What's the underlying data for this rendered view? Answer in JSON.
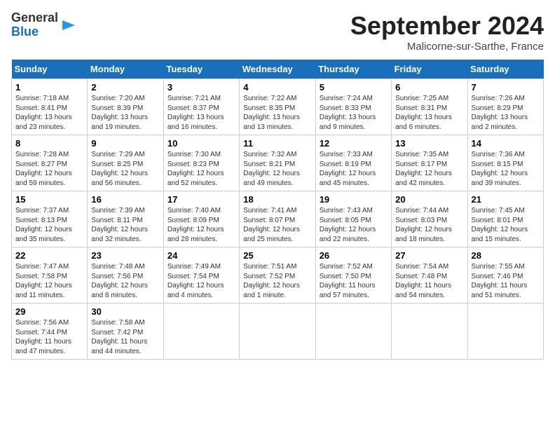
{
  "header": {
    "logo_general": "General",
    "logo_blue": "Blue",
    "title": "September 2024",
    "subtitle": "Malicorne-sur-Sarthe, France"
  },
  "days_of_week": [
    "Sunday",
    "Monday",
    "Tuesday",
    "Wednesday",
    "Thursday",
    "Friday",
    "Saturday"
  ],
  "weeks": [
    [
      {
        "day": "1",
        "info": "Sunrise: 7:18 AM\nSunset: 8:41 PM\nDaylight: 13 hours\nand 23 minutes."
      },
      {
        "day": "2",
        "info": "Sunrise: 7:20 AM\nSunset: 8:39 PM\nDaylight: 13 hours\nand 19 minutes."
      },
      {
        "day": "3",
        "info": "Sunrise: 7:21 AM\nSunset: 8:37 PM\nDaylight: 13 hours\nand 16 minutes."
      },
      {
        "day": "4",
        "info": "Sunrise: 7:22 AM\nSunset: 8:35 PM\nDaylight: 13 hours\nand 13 minutes."
      },
      {
        "day": "5",
        "info": "Sunrise: 7:24 AM\nSunset: 8:33 PM\nDaylight: 13 hours\nand 9 minutes."
      },
      {
        "day": "6",
        "info": "Sunrise: 7:25 AM\nSunset: 8:31 PM\nDaylight: 13 hours\nand 6 minutes."
      },
      {
        "day": "7",
        "info": "Sunrise: 7:26 AM\nSunset: 8:29 PM\nDaylight: 13 hours\nand 2 minutes."
      }
    ],
    [
      {
        "day": "8",
        "info": "Sunrise: 7:28 AM\nSunset: 8:27 PM\nDaylight: 12 hours\nand 59 minutes."
      },
      {
        "day": "9",
        "info": "Sunrise: 7:29 AM\nSunset: 8:25 PM\nDaylight: 12 hours\nand 56 minutes."
      },
      {
        "day": "10",
        "info": "Sunrise: 7:30 AM\nSunset: 8:23 PM\nDaylight: 12 hours\nand 52 minutes."
      },
      {
        "day": "11",
        "info": "Sunrise: 7:32 AM\nSunset: 8:21 PM\nDaylight: 12 hours\nand 49 minutes."
      },
      {
        "day": "12",
        "info": "Sunrise: 7:33 AM\nSunset: 8:19 PM\nDaylight: 12 hours\nand 45 minutes."
      },
      {
        "day": "13",
        "info": "Sunrise: 7:35 AM\nSunset: 8:17 PM\nDaylight: 12 hours\nand 42 minutes."
      },
      {
        "day": "14",
        "info": "Sunrise: 7:36 AM\nSunset: 8:15 PM\nDaylight: 12 hours\nand 39 minutes."
      }
    ],
    [
      {
        "day": "15",
        "info": "Sunrise: 7:37 AM\nSunset: 8:13 PM\nDaylight: 12 hours\nand 35 minutes."
      },
      {
        "day": "16",
        "info": "Sunrise: 7:39 AM\nSunset: 8:11 PM\nDaylight: 12 hours\nand 32 minutes."
      },
      {
        "day": "17",
        "info": "Sunrise: 7:40 AM\nSunset: 8:09 PM\nDaylight: 12 hours\nand 28 minutes."
      },
      {
        "day": "18",
        "info": "Sunrise: 7:41 AM\nSunset: 8:07 PM\nDaylight: 12 hours\nand 25 minutes."
      },
      {
        "day": "19",
        "info": "Sunrise: 7:43 AM\nSunset: 8:05 PM\nDaylight: 12 hours\nand 22 minutes."
      },
      {
        "day": "20",
        "info": "Sunrise: 7:44 AM\nSunset: 8:03 PM\nDaylight: 12 hours\nand 18 minutes."
      },
      {
        "day": "21",
        "info": "Sunrise: 7:45 AM\nSunset: 8:01 PM\nDaylight: 12 hours\nand 15 minutes."
      }
    ],
    [
      {
        "day": "22",
        "info": "Sunrise: 7:47 AM\nSunset: 7:58 PM\nDaylight: 12 hours\nand 11 minutes."
      },
      {
        "day": "23",
        "info": "Sunrise: 7:48 AM\nSunset: 7:56 PM\nDaylight: 12 hours\nand 8 minutes."
      },
      {
        "day": "24",
        "info": "Sunrise: 7:49 AM\nSunset: 7:54 PM\nDaylight: 12 hours\nand 4 minutes."
      },
      {
        "day": "25",
        "info": "Sunrise: 7:51 AM\nSunset: 7:52 PM\nDaylight: 12 hours\nand 1 minute."
      },
      {
        "day": "26",
        "info": "Sunrise: 7:52 AM\nSunset: 7:50 PM\nDaylight: 11 hours\nand 57 minutes."
      },
      {
        "day": "27",
        "info": "Sunrise: 7:54 AM\nSunset: 7:48 PM\nDaylight: 11 hours\nand 54 minutes."
      },
      {
        "day": "28",
        "info": "Sunrise: 7:55 AM\nSunset: 7:46 PM\nDaylight: 11 hours\nand 51 minutes."
      }
    ],
    [
      {
        "day": "29",
        "info": "Sunrise: 7:56 AM\nSunset: 7:44 PM\nDaylight: 11 hours\nand 47 minutes."
      },
      {
        "day": "30",
        "info": "Sunrise: 7:58 AM\nSunset: 7:42 PM\nDaylight: 11 hours\nand 44 minutes."
      },
      {
        "day": "",
        "info": ""
      },
      {
        "day": "",
        "info": ""
      },
      {
        "day": "",
        "info": ""
      },
      {
        "day": "",
        "info": ""
      },
      {
        "day": "",
        "info": ""
      }
    ]
  ]
}
